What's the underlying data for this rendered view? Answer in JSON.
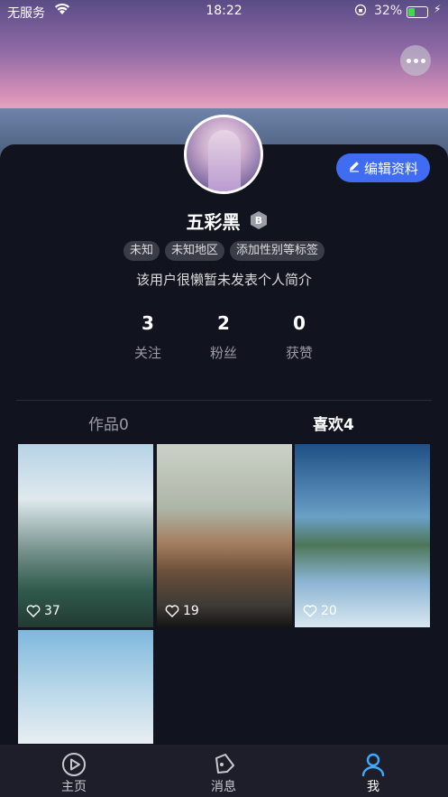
{
  "status_bar": {
    "carrier": "无服务",
    "time": "18:22",
    "battery": "32%",
    "battery_level_pct": 32
  },
  "profile": {
    "username": "五彩黑",
    "badge": "B",
    "tags": [
      "未知",
      "未知地区",
      "添加性别等标签"
    ],
    "bio": "该用户很懒暂未发表个人简介",
    "edit_label": "编辑资料",
    "stats": [
      {
        "value": "3",
        "label": "关注"
      },
      {
        "value": "2",
        "label": "粉丝"
      },
      {
        "value": "0",
        "label": "获赞"
      }
    ]
  },
  "tabs": [
    {
      "label": "作品0",
      "active": false
    },
    {
      "label": "喜欢4",
      "active": true
    }
  ],
  "grid": [
    {
      "likes": "37"
    },
    {
      "likes": "19"
    },
    {
      "likes": "20"
    },
    {
      "likes": ""
    }
  ],
  "nav": [
    {
      "label": "主页",
      "icon": "play-circle-icon"
    },
    {
      "label": "消息",
      "icon": "message-icon"
    },
    {
      "label": "我",
      "icon": "person-icon"
    }
  ],
  "colors": {
    "accent": "#3f6cf1",
    "background": "#11131f",
    "nav_active": "#3fa8ff"
  }
}
